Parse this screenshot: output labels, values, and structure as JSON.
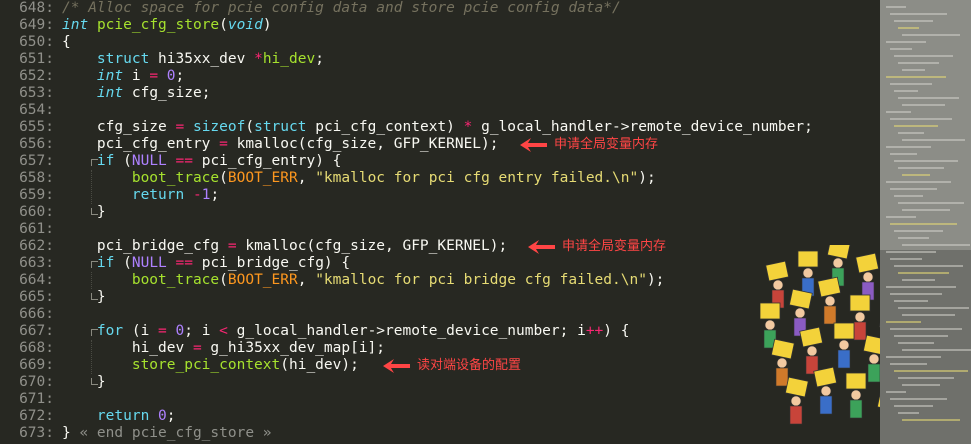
{
  "editor": {
    "lines": [
      {
        "n": "648:",
        "t": [
          [
            "cmt",
            "/* Alloc space for pcie config data and store pcie config data*/"
          ]
        ]
      },
      {
        "n": "649:",
        "t": [
          [
            "kw",
            "int"
          ],
          [
            "",
            " "
          ],
          [
            "fn",
            "pcie_cfg_store"
          ],
          [
            "",
            "("
          ],
          [
            "kw",
            "void"
          ],
          [
            "",
            ")"
          ]
        ]
      },
      {
        "n": "650:",
        "t": [
          [
            "",
            "{"
          ]
        ]
      },
      {
        "n": "651:",
        "t": [
          [
            "",
            "    "
          ],
          [
            "kw2",
            "struct"
          ],
          [
            "",
            " hi35xx_dev "
          ],
          [
            "op",
            "*"
          ],
          [
            "fn",
            "hi_dev"
          ],
          [
            "",
            ";"
          ]
        ]
      },
      {
        "n": "652:",
        "t": [
          [
            "",
            "    "
          ],
          [
            "kw",
            "int"
          ],
          [
            "",
            " i "
          ],
          [
            "op",
            "="
          ],
          [
            "",
            " "
          ],
          [
            "num",
            "0"
          ],
          [
            "",
            ";"
          ]
        ]
      },
      {
        "n": "653:",
        "t": [
          [
            "",
            "    "
          ],
          [
            "kw",
            "int"
          ],
          [
            "",
            " cfg_size;"
          ]
        ]
      },
      {
        "n": "654:",
        "t": [
          [
            "",
            ""
          ]
        ]
      },
      {
        "n": "655:",
        "t": [
          [
            "",
            "    cfg_size "
          ],
          [
            "op",
            "="
          ],
          [
            "",
            " "
          ],
          [
            "kw2",
            "sizeof"
          ],
          [
            "",
            "("
          ],
          [
            "kw2",
            "struct"
          ],
          [
            "",
            " pci_cfg_context) "
          ],
          [
            "op",
            "*"
          ],
          [
            "",
            " g_local_handler->remote_device_number;"
          ]
        ]
      },
      {
        "n": "656:",
        "t": [
          [
            "",
            "    pci_cfg_entry "
          ],
          [
            "op",
            "="
          ],
          [
            "",
            " kmalloc(cfg_size, GFP_KERNEL);"
          ]
        ]
      },
      {
        "n": "657:",
        "t": [
          [
            "",
            "    "
          ],
          [
            "ctl",
            "if"
          ],
          [
            "",
            " ("
          ],
          [
            "con",
            "NULL"
          ],
          [
            "",
            " "
          ],
          [
            "op",
            "=="
          ],
          [
            "",
            " pci_cfg_entry) {"
          ]
        ]
      },
      {
        "n": "658:",
        "t": [
          [
            "",
            "        "
          ],
          [
            "fn",
            "boot_trace"
          ],
          [
            "",
            "("
          ],
          [
            "mac",
            "BOOT_ERR"
          ],
          [
            "",
            ", "
          ],
          [
            "str",
            "\"kmalloc for pci cfg entry failed.\\n\""
          ],
          [
            "",
            ");"
          ]
        ]
      },
      {
        "n": "659:",
        "t": [
          [
            "",
            "        "
          ],
          [
            "ctl",
            "return"
          ],
          [
            "",
            " "
          ],
          [
            "op",
            "-"
          ],
          [
            "num",
            "1"
          ],
          [
            "",
            ";"
          ]
        ]
      },
      {
        "n": "660:",
        "t": [
          [
            "",
            "    }"
          ]
        ]
      },
      {
        "n": "661:",
        "t": [
          [
            "",
            ""
          ]
        ]
      },
      {
        "n": "662:",
        "t": [
          [
            "",
            "    pci_bridge_cfg "
          ],
          [
            "op",
            "="
          ],
          [
            "",
            " kmalloc(cfg_size, GFP_KERNEL);"
          ]
        ]
      },
      {
        "n": "663:",
        "t": [
          [
            "",
            "    "
          ],
          [
            "ctl",
            "if"
          ],
          [
            "",
            " ("
          ],
          [
            "con",
            "NULL"
          ],
          [
            "",
            " "
          ],
          [
            "op",
            "=="
          ],
          [
            "",
            " pci_bridge_cfg) {"
          ]
        ]
      },
      {
        "n": "664:",
        "t": [
          [
            "",
            "        "
          ],
          [
            "fn",
            "boot_trace"
          ],
          [
            "",
            "("
          ],
          [
            "mac",
            "BOOT_ERR"
          ],
          [
            "",
            ", "
          ],
          [
            "str",
            "\"kmalloc for pci bridge cfg failed.\\n\""
          ],
          [
            "",
            ");"
          ]
        ]
      },
      {
        "n": "665:",
        "t": [
          [
            "",
            "    }"
          ]
        ]
      },
      {
        "n": "666:",
        "t": [
          [
            "",
            ""
          ]
        ]
      },
      {
        "n": "667:",
        "t": [
          [
            "",
            "    "
          ],
          [
            "ctl",
            "for"
          ],
          [
            "",
            " (i "
          ],
          [
            "op",
            "="
          ],
          [
            "",
            " "
          ],
          [
            "num",
            "0"
          ],
          [
            "",
            "; i "
          ],
          [
            "op",
            "<"
          ],
          [
            "",
            " g_local_handler->remote_device_number; i"
          ],
          [
            "op",
            "++"
          ],
          [
            "",
            ") {"
          ]
        ]
      },
      {
        "n": "668:",
        "t": [
          [
            "",
            "        hi_dev "
          ],
          [
            "op",
            "="
          ],
          [
            "",
            " g_hi35xx_dev_map[i];"
          ]
        ]
      },
      {
        "n": "669:",
        "t": [
          [
            "",
            "        "
          ],
          [
            "fn",
            "store_pci_context"
          ],
          [
            "",
            "(hi_dev);"
          ]
        ]
      },
      {
        "n": "670:",
        "t": [
          [
            "",
            "    }"
          ]
        ]
      },
      {
        "n": "671:",
        "t": [
          [
            "",
            ""
          ]
        ]
      },
      {
        "n": "672:",
        "t": [
          [
            "",
            "    "
          ],
          [
            "ctl",
            "return"
          ],
          [
            "",
            " "
          ],
          [
            "num",
            "0"
          ],
          [
            "",
            ";"
          ]
        ]
      },
      {
        "n": "673:",
        "t": [
          [
            "",
            "} "
          ],
          [
            "dim",
            "« end pcie_cfg_store »"
          ]
        ]
      }
    ]
  },
  "annotations": [
    {
      "line_index": 8,
      "text": "申请全局变量内存"
    },
    {
      "line_index": 14,
      "text": "申请全局变量内存"
    },
    {
      "line_index": 21,
      "text": "读对端设备的配置"
    }
  ],
  "colors": {
    "background": "#272822",
    "gutter_text": "#90908a",
    "keyword": "#66d9ef",
    "function": "#a6e22e",
    "string": "#e6db74",
    "number": "#ae81ff",
    "operator": "#f92672",
    "comment": "#75715e",
    "annotation": "#ff4545",
    "minimap": "#6f706b"
  }
}
